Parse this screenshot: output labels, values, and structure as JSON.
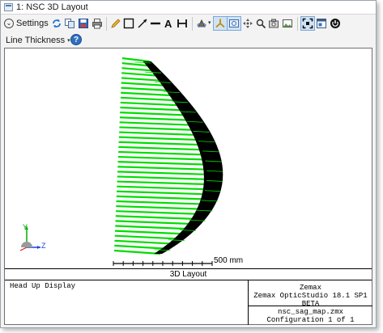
{
  "window": {
    "title": "1: NSC 3D Layout"
  },
  "toolbar": {
    "settings_label": "Settings",
    "line_thickness_label": "Line Thickness",
    "icons": [
      "refresh-icon",
      "copy-icon",
      "save-icon",
      "print-icon",
      "pencil-icon",
      "rectangle-icon",
      "arrow-icon",
      "line-icon",
      "text-icon",
      "dimension-icon",
      "rotate-icon",
      "axes-icon",
      "rotate-view-icon",
      "pan-icon",
      "zoom-icon",
      "camera-icon",
      "image-icon",
      "fit-icon",
      "window-icon",
      "power-icon"
    ]
  },
  "plot": {
    "title": "3D Layout",
    "hud_label": "Head Up Display",
    "scale_label": "500 mm",
    "axis_labels": {
      "x": "Y",
      "z": "Z"
    },
    "software": "Zemax",
    "version": "Zemax OpticStudio 18.1 SP1 BETA",
    "file": "nsc_sag_map.zmx",
    "configuration": "Configuration 1 of 1",
    "colors": {
      "rays": "#00dd00",
      "surface": "#000000"
    }
  }
}
